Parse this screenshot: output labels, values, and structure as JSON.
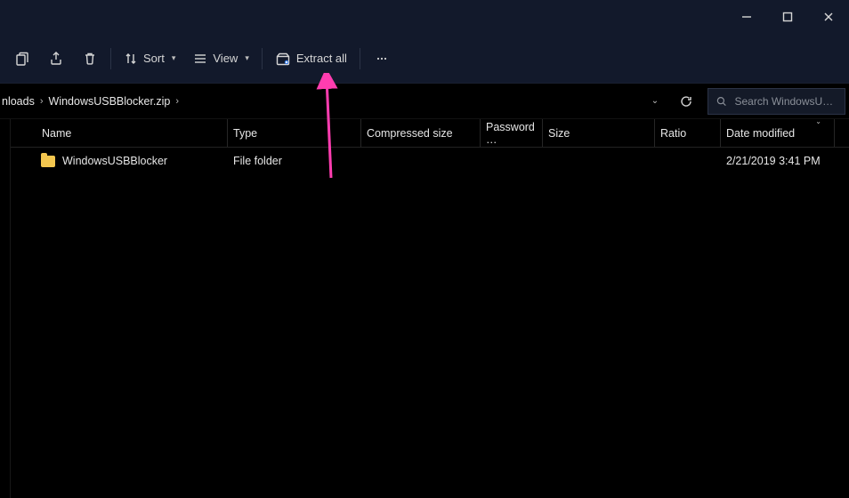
{
  "toolbar": {
    "sort_label": "Sort",
    "view_label": "View",
    "extract_label": "Extract all"
  },
  "breadcrumbs": {
    "seg1": "nloads",
    "seg2": "WindowsUSBBlocker.zip"
  },
  "search": {
    "placeholder": "Search WindowsU…"
  },
  "columns": {
    "name": "Name",
    "type": "Type",
    "compressed": "Compressed size",
    "password": "Password …",
    "size": "Size",
    "ratio": "Ratio",
    "date": "Date modified"
  },
  "rows": [
    {
      "name": "WindowsUSBBlocker",
      "type": "File folder",
      "compressed": "",
      "password": "",
      "size": "",
      "ratio": "",
      "date": "2/21/2019 3:41 PM"
    }
  ]
}
